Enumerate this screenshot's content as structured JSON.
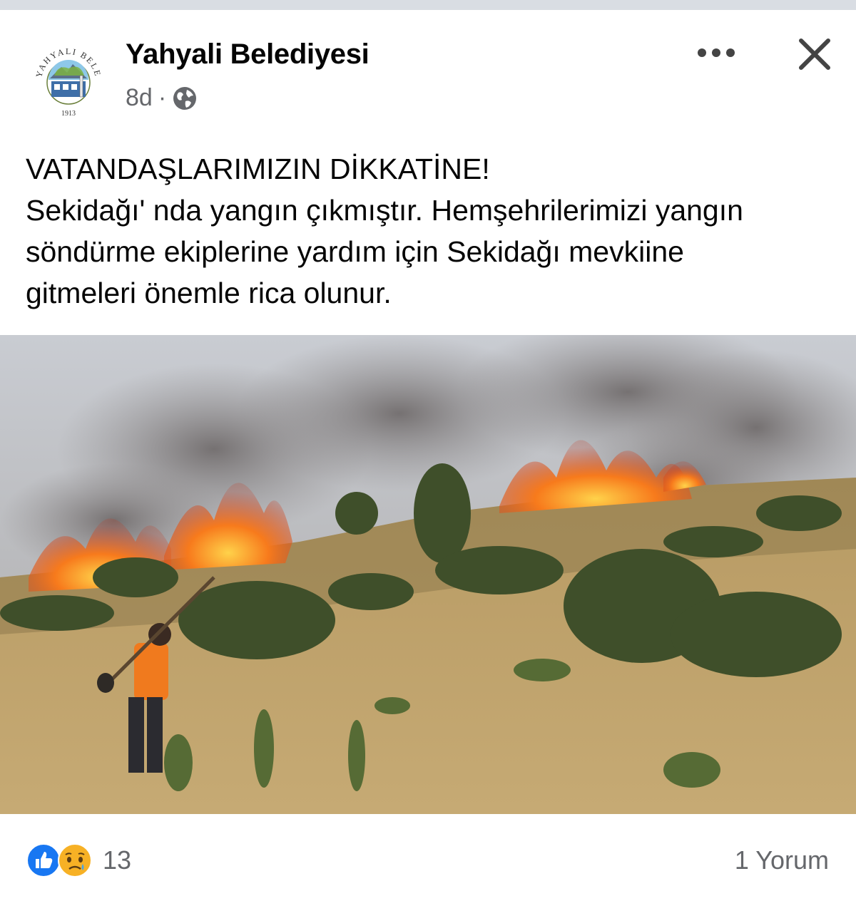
{
  "page": {
    "name": "Yahyali Belediyesi",
    "timestamp": "8d",
    "separator": "·",
    "privacy_icon": "globe-icon",
    "logo": {
      "top_text": "YAHYALI BELEDİYESİ",
      "year": "1913"
    }
  },
  "controls": {
    "more_icon": "ellipsis-icon",
    "close_icon": "close-icon"
  },
  "post": {
    "lines": [
      "VATANDAŞLARIMIZIN DİKKATİNE!",
      "Sekidağı' nda yangın çıkmıştır. Hemşehrilerimizi yangın",
      "söndürme ekiplerine yardım için Sekidağı mevkiine",
      "gitmeleri önemle rica olunur."
    ]
  },
  "footer": {
    "reaction_icons": [
      "like-icon",
      "sad-icon"
    ],
    "reaction_count": "13",
    "comments": "1 Yorum"
  },
  "colors": {
    "text": "#050505",
    "secondary": "#65676b",
    "like_blue": "#1877f2",
    "sad_yellow": "#f7b125"
  }
}
